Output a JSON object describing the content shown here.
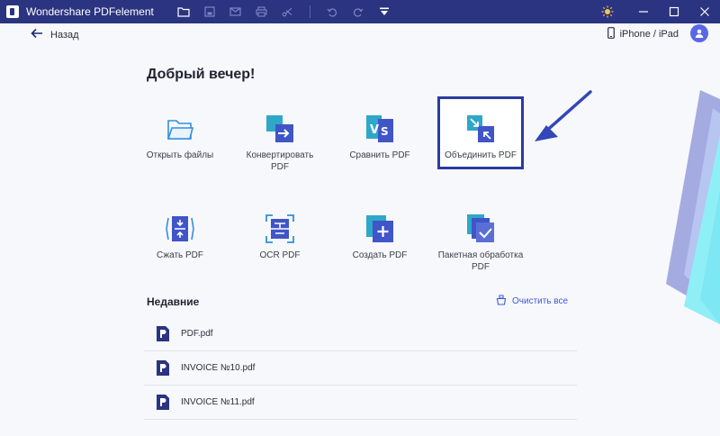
{
  "titlebar": {
    "app_title": "Wondershare PDFelement",
    "icons": [
      "folder-icon",
      "save-icon",
      "mail-icon",
      "print-icon",
      "share-icon",
      "undo-icon",
      "redo-icon",
      "dropdown-icon"
    ],
    "window_controls": [
      "theme-icon",
      "minimize-icon",
      "maximize-icon",
      "close-icon"
    ]
  },
  "nav": {
    "back_label": "Назад",
    "device_label": "iPhone / iPad"
  },
  "greeting": "Добрый вечер!",
  "tiles": [
    {
      "label": "Открыть файлы",
      "icon": "folder-open-icon"
    },
    {
      "label": "Конвертировать PDF",
      "icon": "convert-icon"
    },
    {
      "label": "Сравнить PDF",
      "icon": "compare-icon"
    },
    {
      "label": "Объединить PDF",
      "icon": "merge-icon",
      "highlighted": true
    },
    {
      "label": "Сжать PDF",
      "icon": "compress-icon"
    },
    {
      "label": "OCR PDF",
      "icon": "ocr-icon"
    },
    {
      "label": "Создать PDF",
      "icon": "create-icon"
    },
    {
      "label": "Пакетная обработка PDF",
      "icon": "batch-icon"
    }
  ],
  "recent": {
    "title": "Недавние",
    "clear_label": "Очистить все",
    "files": [
      {
        "name": "PDF.pdf"
      },
      {
        "name": "INVOICE №10.pdf"
      },
      {
        "name": "INVOICE №11.pdf"
      }
    ]
  },
  "colors": {
    "titlebar": "#2b3480",
    "accent": "#3d5bd9",
    "highlight_border": "#2b3ba0",
    "annotation_arrow": "#3347b8"
  }
}
